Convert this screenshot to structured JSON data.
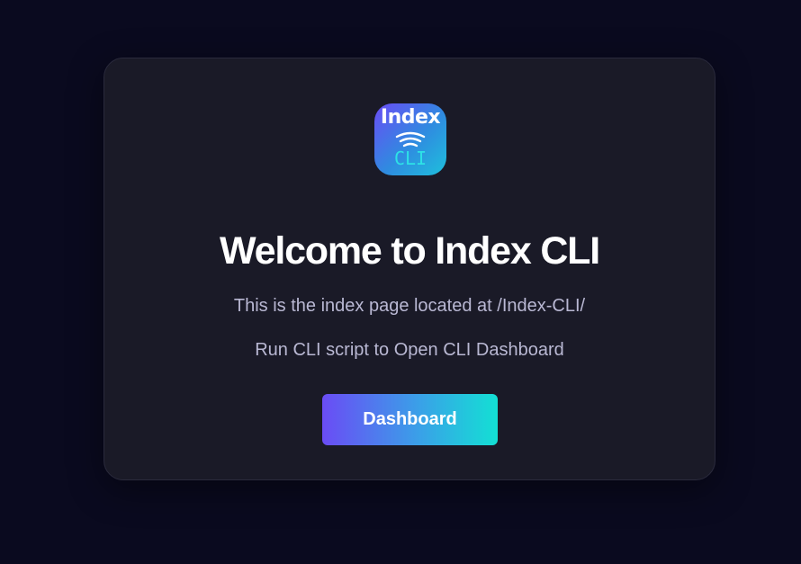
{
  "logo": {
    "top_text": "Index",
    "bottom_text": "CLI",
    "icon": "wifi-waves-icon"
  },
  "main": {
    "title": "Welcome to Index CLI",
    "description": "This is the index page located at /Index-CLI/",
    "instruction": "Run CLI script to Open CLI Dashboard",
    "button_label": "Dashboard"
  },
  "colors": {
    "background": "#0a0a1f",
    "card": "#1a1a27",
    "accent_start": "#6a4cf5",
    "accent_end": "#13e0d4",
    "muted_text": "#b9b8d3"
  }
}
